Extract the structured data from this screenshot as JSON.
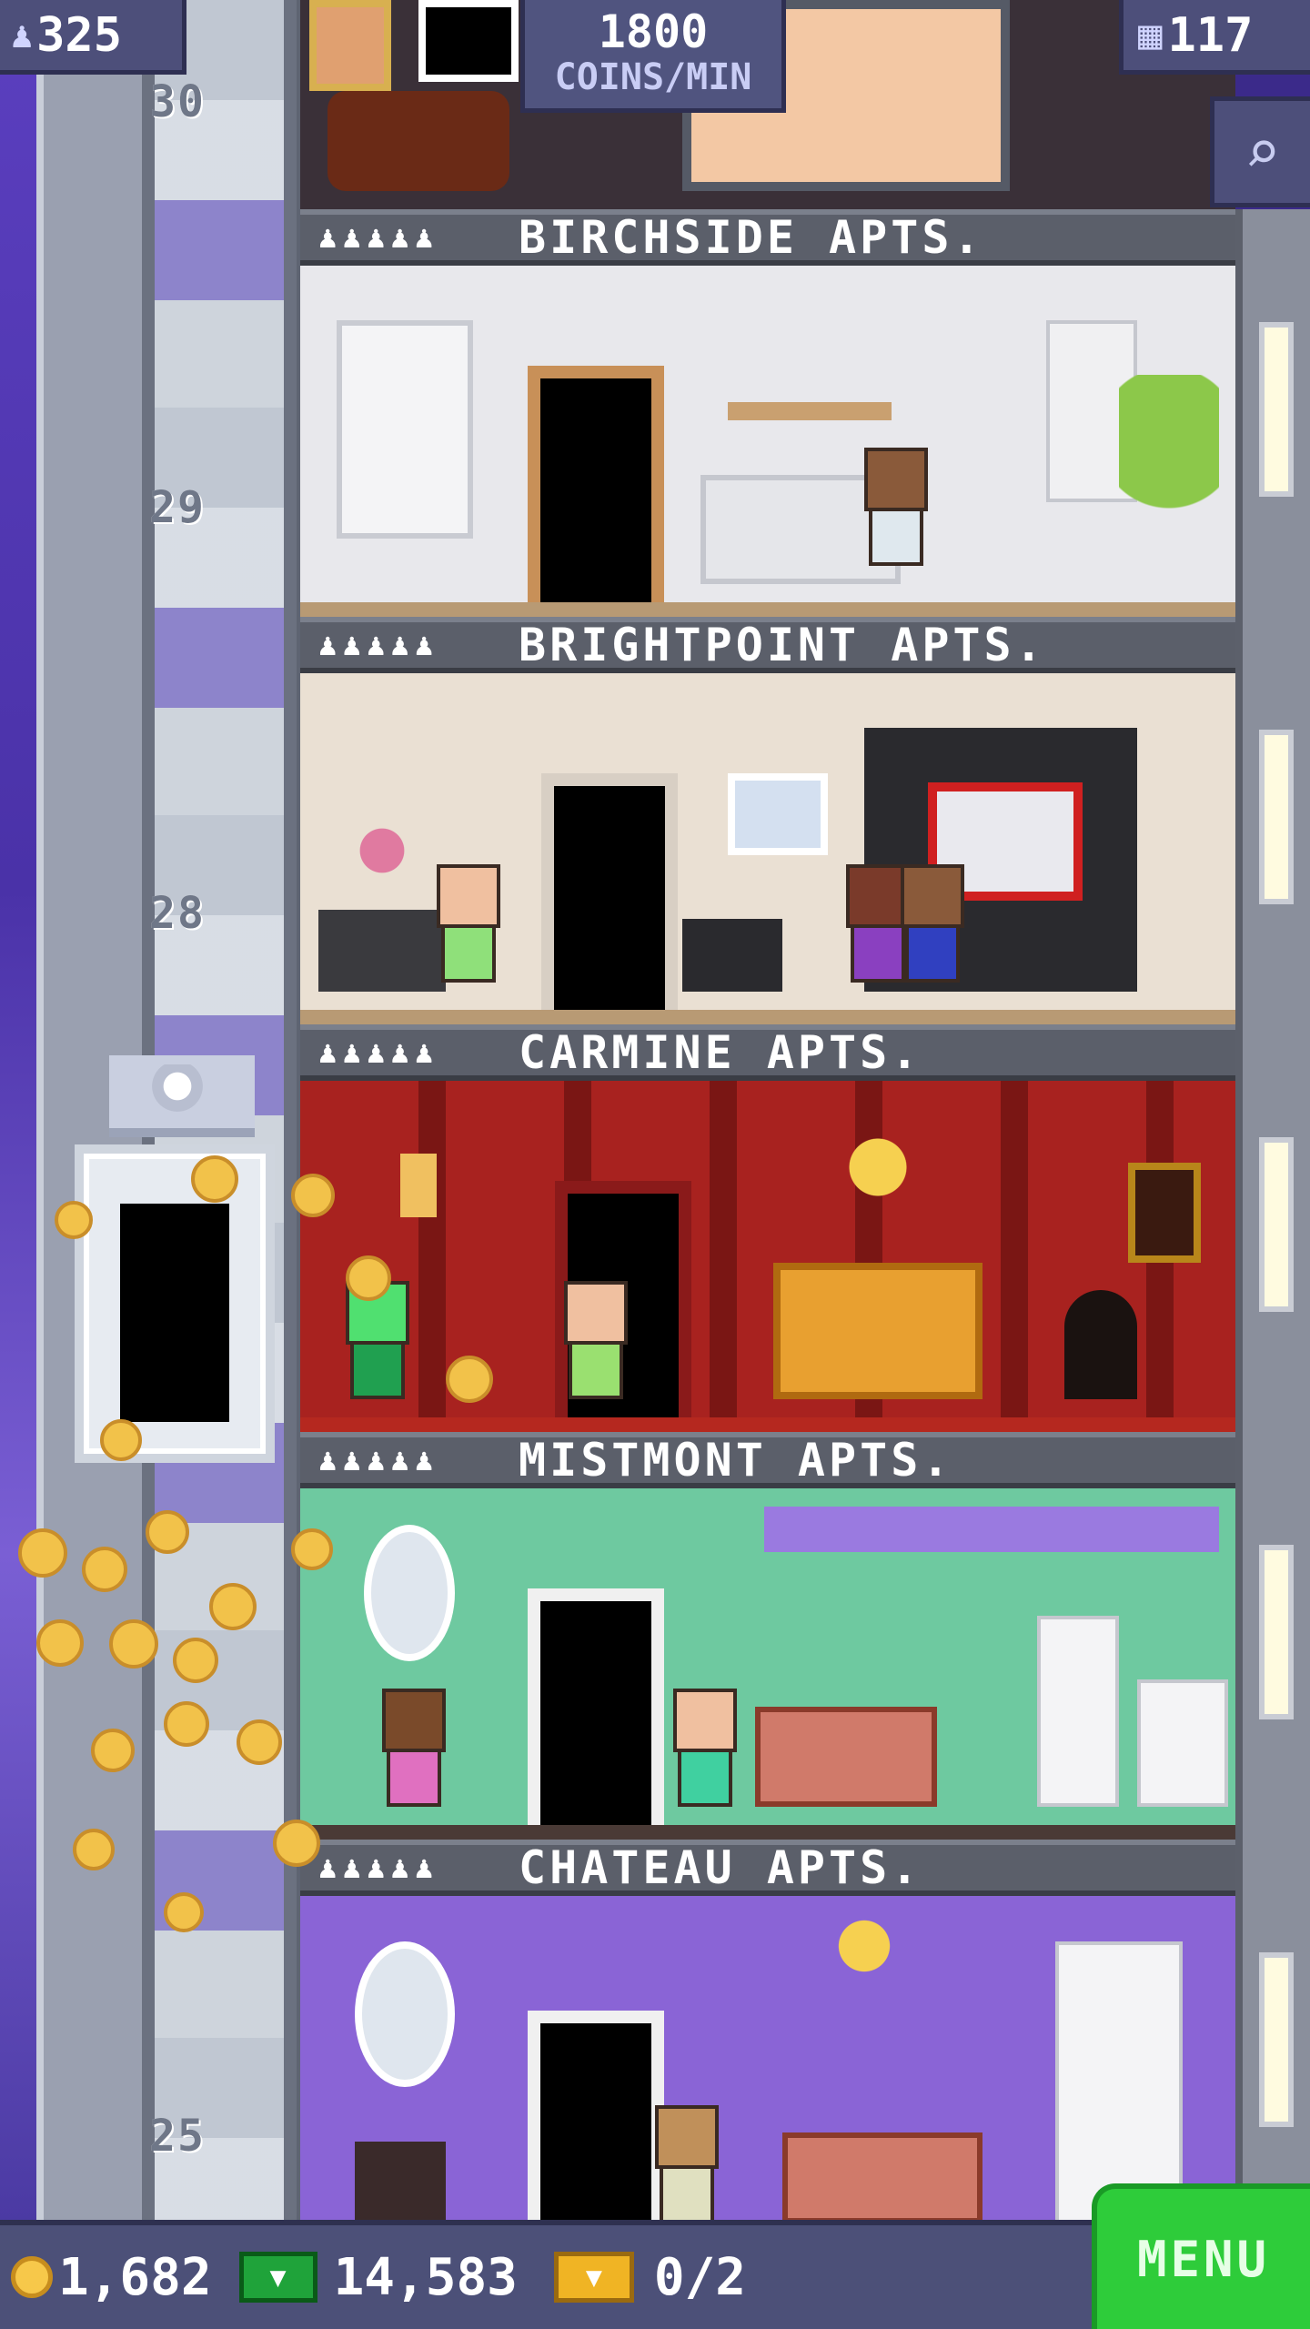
{
  "hud": {
    "population": "325",
    "coins_rate_value": "1800",
    "coins_rate_unit": "COINS/MIN",
    "floor_count": "117",
    "population_icon": "person-icon",
    "floors_icon": "building-icon",
    "search_icon": "magnifier-icon"
  },
  "elevator": {
    "floor_numbers": [
      "30",
      "29",
      "28",
      "25"
    ]
  },
  "floors": [
    {
      "people": "♟♟♟♟♟",
      "name": "BIRCHSIDE APTS."
    },
    {
      "people": "♟♟♟♟♟",
      "name": "BRIGHTPOINT APTS."
    },
    {
      "people": "♟♟♟♟♟",
      "name": "CARMINE APTS."
    },
    {
      "people": "♟♟♟♟♟",
      "name": "MISTMONT APTS."
    },
    {
      "people": "♟♟♟♟♟",
      "name": "CHATEAU APTS."
    }
  ],
  "bottom": {
    "coins": "1,682",
    "bux": "14,583",
    "tickets": "0/2",
    "menu_label": "MENU"
  },
  "colors": {
    "hud_bg": "#4d4f7a",
    "menu_green": "#2ecc3a",
    "coin_gold": "#f7c84a",
    "bux_green": "#1fa33a"
  }
}
